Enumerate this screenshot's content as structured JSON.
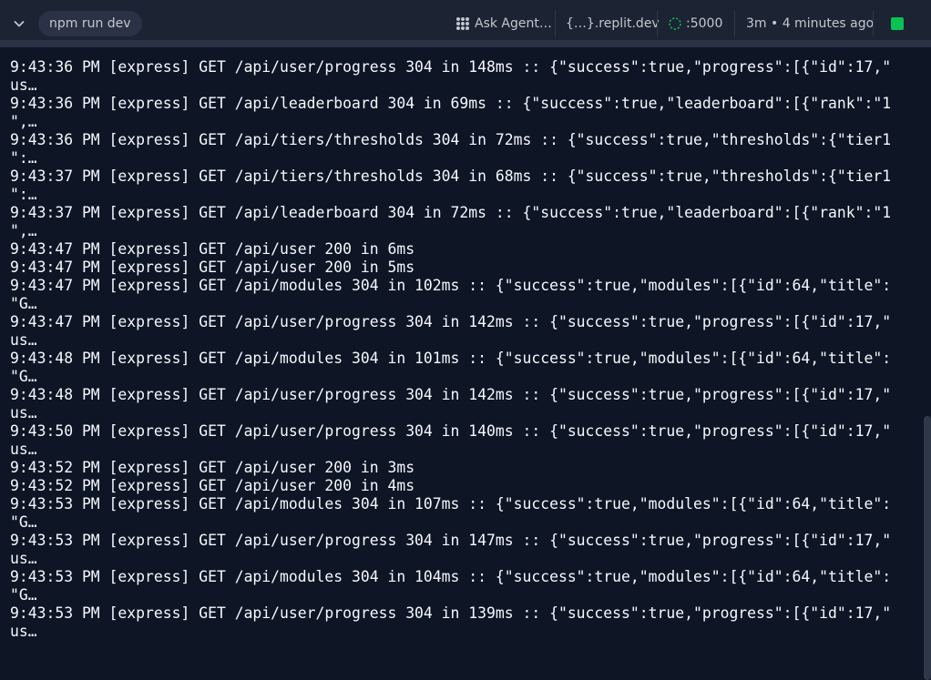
{
  "topbar": {
    "command_label": "npm run dev",
    "agent_label": "Ask Agent…",
    "domain_label": "{…}.replit.dev",
    "port_label": ":5000",
    "time_label": "3m • 4 minutes ago",
    "colors": {
      "background": "#1c2333",
      "pill": "#2b3245",
      "run_indicator": "#0ac254",
      "text": "#c2c8cc"
    },
    "icons": [
      "chevron-down-icon",
      "agent-icon",
      "port-icon",
      "running-status-icon"
    ]
  },
  "console": {
    "colors": {
      "background": "#0e1525",
      "text": "#f5f9fc"
    },
    "lines": [
      "9:43:36 PM [express] GET /api/user/progress 304 in 148ms :: {\"success\":true,\"progress\":[{\"id\":17,\"",
      "us…",
      "9:43:36 PM [express] GET /api/leaderboard 304 in 69ms :: {\"success\":true,\"leaderboard\":[{\"rank\":\"1",
      "\",…",
      "9:43:36 PM [express] GET /api/tiers/thresholds 304 in 72ms :: {\"success\":true,\"thresholds\":{\"tier1",
      "\":…",
      "9:43:37 PM [express] GET /api/tiers/thresholds 304 in 68ms :: {\"success\":true,\"thresholds\":{\"tier1",
      "\":…",
      "9:43:37 PM [express] GET /api/leaderboard 304 in 72ms :: {\"success\":true,\"leaderboard\":[{\"rank\":\"1",
      "\",…",
      "9:43:47 PM [express] GET /api/user 200 in 6ms",
      "9:43:47 PM [express] GET /api/user 200 in 5ms",
      "9:43:47 PM [express] GET /api/modules 304 in 102ms :: {\"success\":true,\"modules\":[{\"id\":64,\"title\":",
      "\"G…",
      "9:43:47 PM [express] GET /api/user/progress 304 in 142ms :: {\"success\":true,\"progress\":[{\"id\":17,\"",
      "us…",
      "9:43:48 PM [express] GET /api/modules 304 in 101ms :: {\"success\":true,\"modules\":[{\"id\":64,\"title\":",
      "\"G…",
      "9:43:48 PM [express] GET /api/user/progress 304 in 142ms :: {\"success\":true,\"progress\":[{\"id\":17,\"",
      "us…",
      "9:43:50 PM [express] GET /api/user/progress 304 in 140ms :: {\"success\":true,\"progress\":[{\"id\":17,\"",
      "us…",
      "9:43:52 PM [express] GET /api/user 200 in 3ms",
      "9:43:52 PM [express] GET /api/user 200 in 4ms",
      "9:43:53 PM [express] GET /api/modules 304 in 107ms :: {\"success\":true,\"modules\":[{\"id\":64,\"title\":",
      "\"G…",
      "9:43:53 PM [express] GET /api/user/progress 304 in 147ms :: {\"success\":true,\"progress\":[{\"id\":17,\"",
      "us…",
      "9:43:53 PM [express] GET /api/modules 304 in 104ms :: {\"success\":true,\"modules\":[{\"id\":64,\"title\":",
      "\"G…",
      "9:43:53 PM [express] GET /api/user/progress 304 in 139ms :: {\"success\":true,\"progress\":[{\"id\":17,\"",
      "us…"
    ]
  }
}
